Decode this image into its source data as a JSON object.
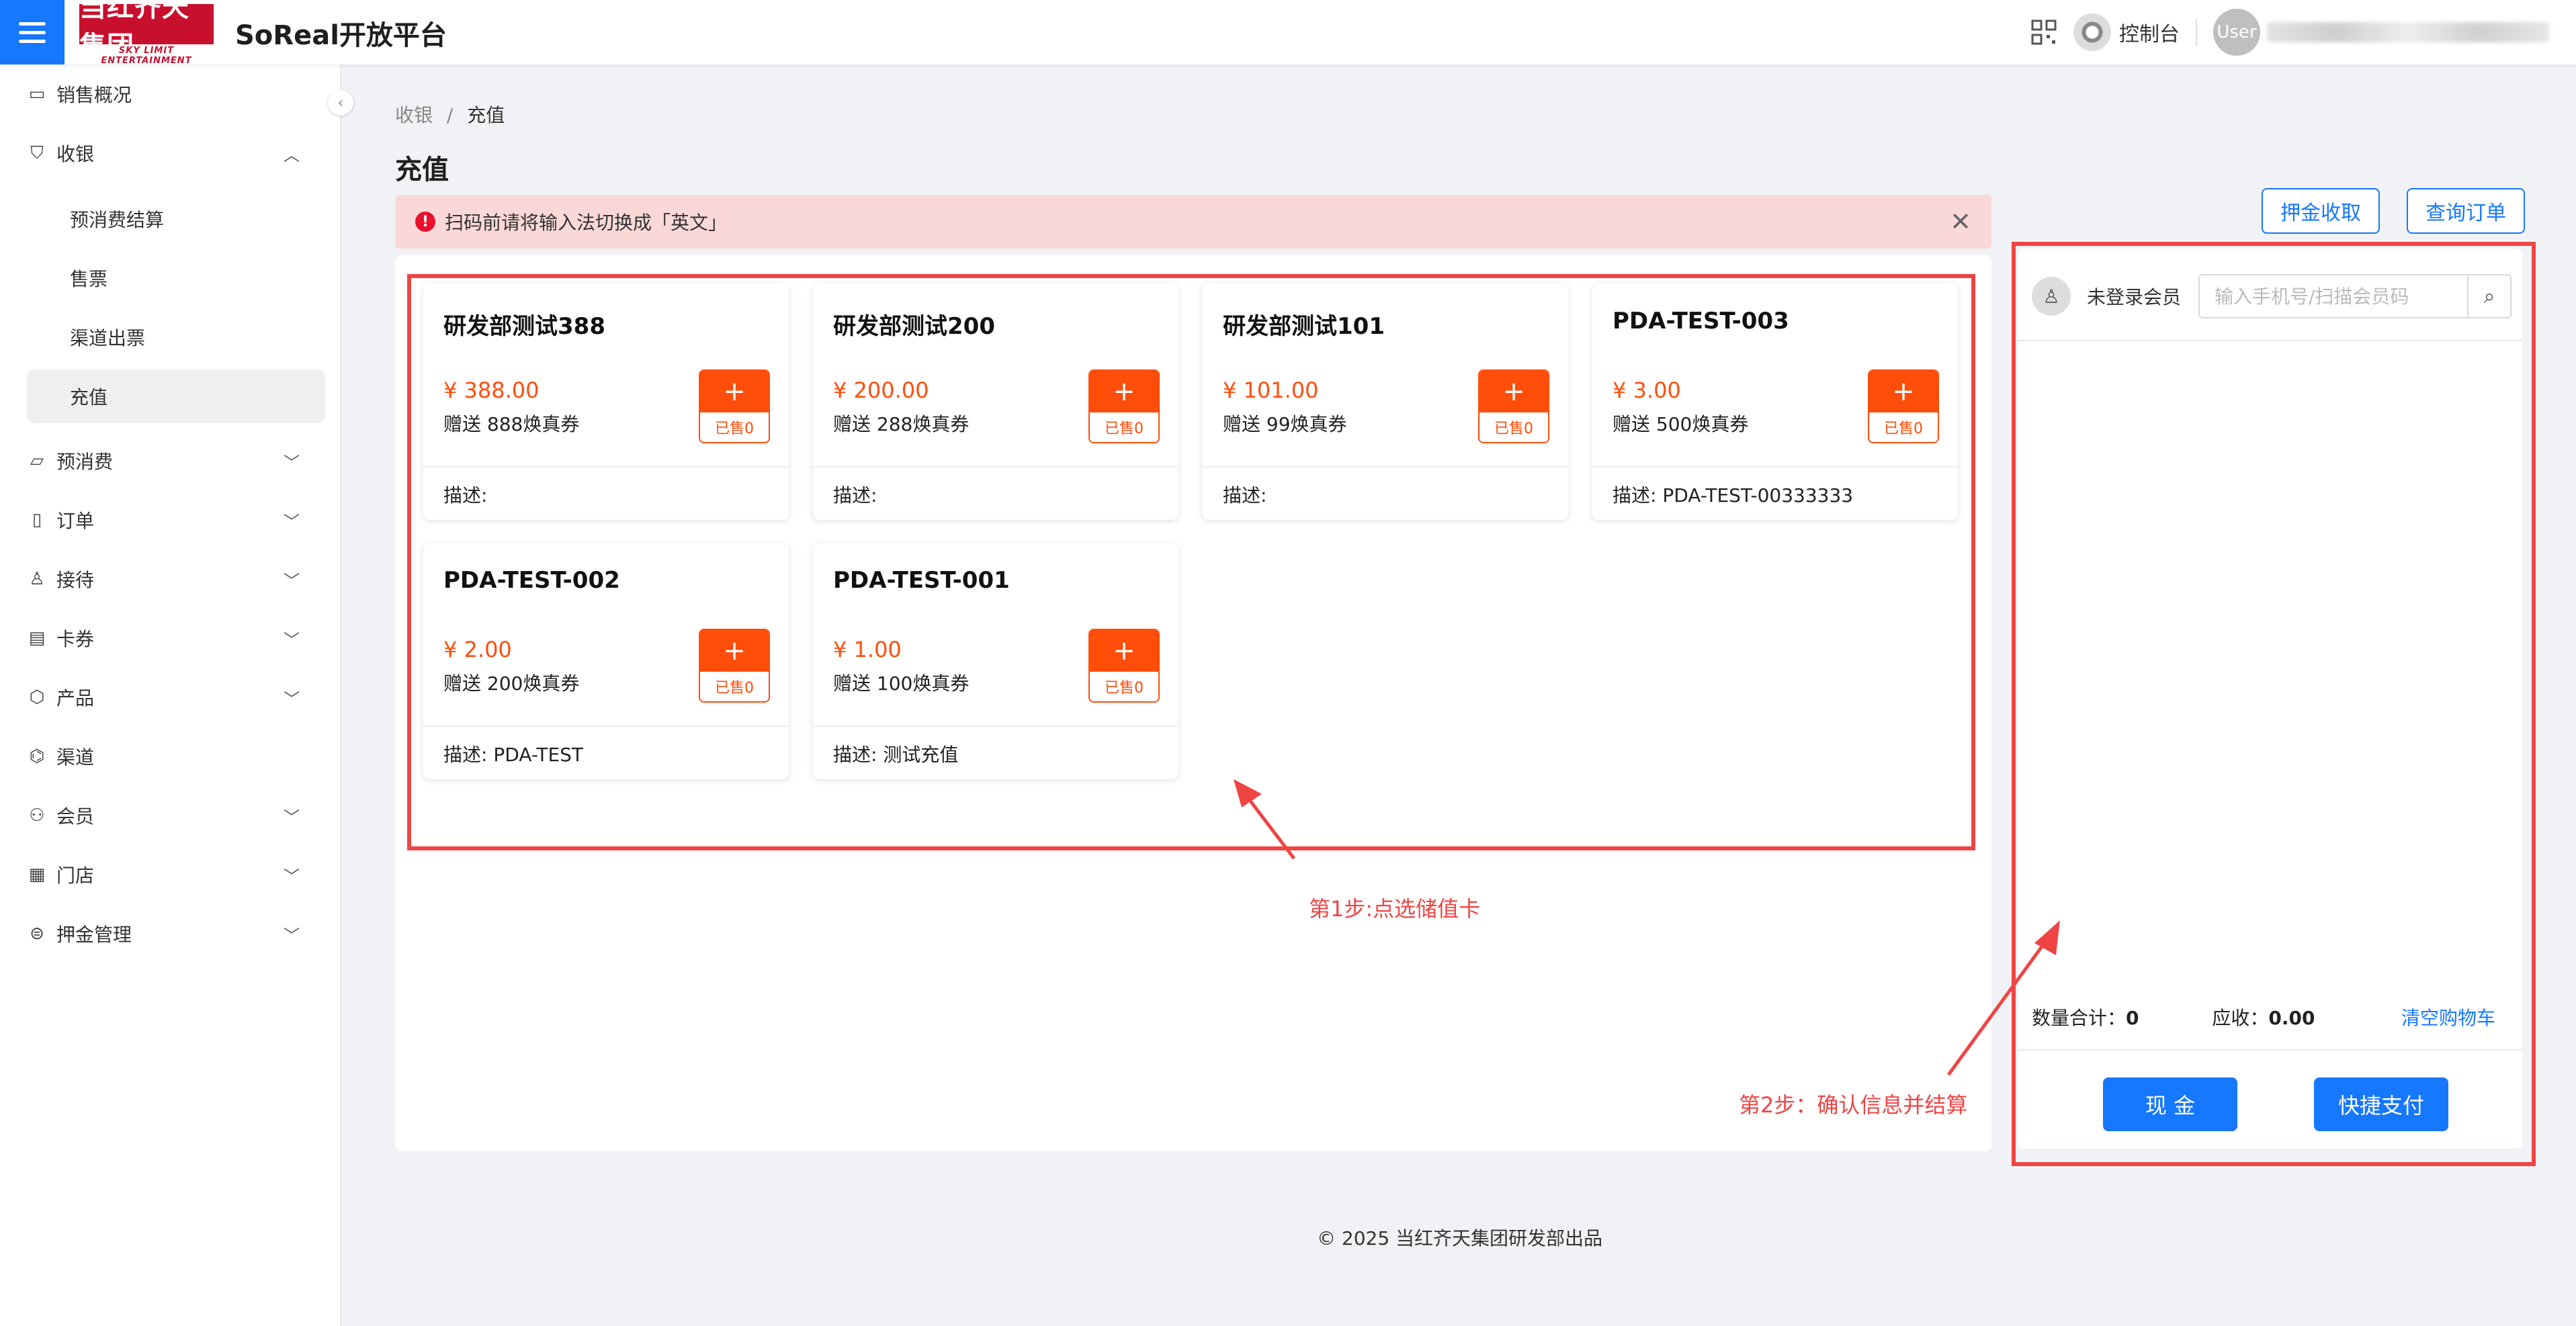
{
  "header": {
    "logo_text": "当红齐天集团",
    "logo_sub": "SKY LIMIT ENTERTAINMENT",
    "app_title": "SoReal开放平台",
    "console_label": "控制台",
    "avatar_text": "User"
  },
  "sidebar": {
    "items": [
      {
        "label": "销售概况",
        "icon": "monitor-icon"
      },
      {
        "label": "收银",
        "icon": "shield-icon"
      },
      {
        "label": "预消费",
        "icon": "folder-icon"
      },
      {
        "label": "订单",
        "icon": "file-icon"
      },
      {
        "label": "接待",
        "icon": "user-icon"
      },
      {
        "label": "卡券",
        "icon": "card-icon"
      },
      {
        "label": "产品",
        "icon": "box-icon"
      },
      {
        "label": "渠道",
        "icon": "channel-icon"
      },
      {
        "label": "会员",
        "icon": "members-icon"
      },
      {
        "label": "门店",
        "icon": "store-icon"
      },
      {
        "label": "押金管理",
        "icon": "deposit-icon"
      }
    ],
    "sub_items": [
      "预消费结算",
      "售票",
      "渠道出票",
      "充值"
    ]
  },
  "breadcrumb": {
    "parent": "收银",
    "sep": "/",
    "current": "充值"
  },
  "page_title": "充值",
  "alert": {
    "text": "扫码前请将输入法切换成「英文」"
  },
  "cards": [
    {
      "name": "研发部测试388",
      "price": "¥ 388.00",
      "gift": "赠送 888焕真券",
      "sold": "已售0",
      "desc": "描述:"
    },
    {
      "name": "研发部测试200",
      "price": "¥ 200.00",
      "gift": "赠送 288焕真券",
      "sold": "已售0",
      "desc": "描述:"
    },
    {
      "name": "研发部测试101",
      "price": "¥ 101.00",
      "gift": "赠送 99焕真券",
      "sold": "已售0",
      "desc": "描述:"
    },
    {
      "name": "PDA-TEST-003",
      "price": "¥ 3.00",
      "gift": "赠送 500焕真券",
      "sold": "已售0",
      "desc": "描述: PDA-TEST-00333333"
    },
    {
      "name": "PDA-TEST-002",
      "price": "¥ 2.00",
      "gift": "赠送 200焕真券",
      "sold": "已售0",
      "desc": "描述: PDA-TEST"
    },
    {
      "name": "PDA-TEST-001",
      "price": "¥ 1.00",
      "gift": "赠送 100焕真券",
      "sold": "已售0",
      "desc": "描述: 测试充值"
    }
  ],
  "plus_glyph": "+",
  "annotations": {
    "step1": "第1步:点选储值卡",
    "step2": "第2步：确认信息并结算"
  },
  "actions": {
    "deposit": "押金收取",
    "query_orders": "查询订单"
  },
  "cart": {
    "member_label": "未登录会员",
    "search_placeholder": "输入手机号/扫描会员码",
    "qty_label": "数量合计：",
    "qty_value": "0",
    "due_label": "应收：",
    "due_value": "0.00",
    "clear_label": "清空购物车",
    "cash_label": "现 金",
    "quick_pay_label": "快捷支付"
  },
  "footer": {
    "text": "© 2025 当红齐天集团研发部出品"
  },
  "colors": {
    "primary": "#1677ff",
    "price": "#ff4d0a",
    "annotation": "#ef4444",
    "alert_bg": "#fbd8d8"
  }
}
